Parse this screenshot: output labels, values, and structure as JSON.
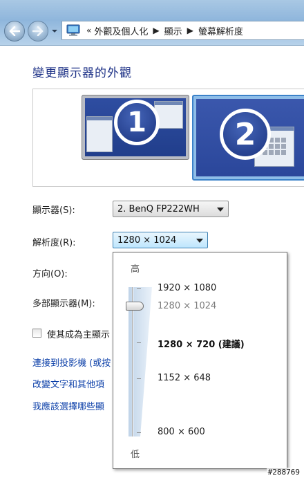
{
  "breadcrumb": {
    "overflow": "«",
    "items": [
      "外觀及個人化",
      "顯示",
      "螢幕解析度"
    ]
  },
  "page": {
    "title": "變更顯示器的外觀"
  },
  "monitors": [
    {
      "number": "1",
      "selected": false
    },
    {
      "number": "2",
      "selected": true
    }
  ],
  "form": {
    "display_label": "顯示器(S):",
    "display_value": "2. BenQ FP222WH",
    "resolution_label": "解析度(R):",
    "resolution_value": "1280 × 1024",
    "orientation_label": "方向(O):",
    "multi_label": "多部顯示器(M):",
    "primary_checkbox_label": "使其成為主顯示",
    "primary_checked": false
  },
  "links": [
    "連接到投影機 (或按",
    "改變文字和其他項",
    "我應該選擇哪些顯"
  ],
  "resolution_popup": {
    "high_label": "高",
    "low_label": "低",
    "options": [
      {
        "label": "1920 × 1080",
        "state": "normal"
      },
      {
        "label": "1280 × 1024",
        "state": "current"
      },
      {
        "label": "1280 × 720 (建議)",
        "state": "recommended"
      },
      {
        "label": "1152 × 648",
        "state": "normal"
      },
      {
        "label": "800 × 600",
        "state": "normal"
      }
    ],
    "slider_selected": "1280 × 1024"
  },
  "watermark": "#288769",
  "colors": {
    "title": "#1e3287",
    "link": "#0a3ea8",
    "selected_monitor_border": "#3b82c9"
  },
  "icons": {
    "back": "back-arrow-icon",
    "forward": "forward-arrow-icon",
    "address": "control-panel-icon"
  }
}
